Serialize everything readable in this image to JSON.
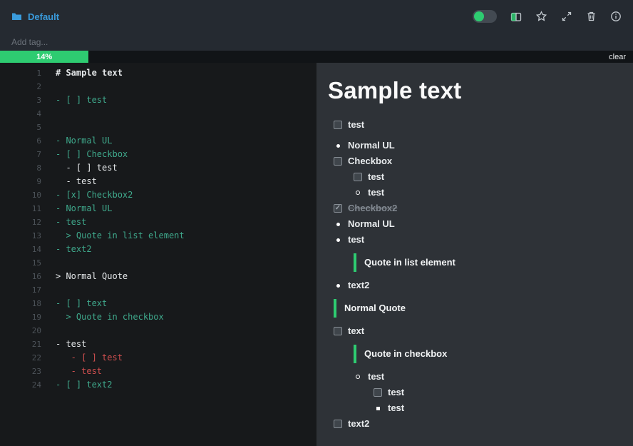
{
  "colors": {
    "accent_green": "#2ecc71",
    "accent_blue": "#3a9bdc",
    "teal_text": "#3fa98c",
    "red_text": "#cf4f4f"
  },
  "header": {
    "notebook": "Default",
    "tag_placeholder": "Add tag...",
    "icons": [
      "folder-icon",
      "preview-toggle",
      "split-view-icon",
      "star-icon",
      "expand-icon",
      "trash-icon",
      "info-icon"
    ]
  },
  "progress": {
    "value": 14,
    "percent_label": "14%",
    "clear_label": "clear"
  },
  "editor": {
    "lines": [
      {
        "num": 1,
        "text": "# Sample text",
        "color": "white",
        "bold": true
      },
      {
        "num": 2,
        "text": ""
      },
      {
        "num": 3,
        "text": "- [ ] test",
        "color": "teal"
      },
      {
        "num": 4,
        "text": ""
      },
      {
        "num": 5,
        "text": ""
      },
      {
        "num": 6,
        "text": "- Normal UL",
        "color": "teal"
      },
      {
        "num": 7,
        "text": "- [ ] Checkbox",
        "color": "teal"
      },
      {
        "num": 8,
        "text": "  - [ ] test",
        "color": "white"
      },
      {
        "num": 9,
        "text": "  - test",
        "color": "white"
      },
      {
        "num": 10,
        "text": "- [x] Checkbox2",
        "color": "teal"
      },
      {
        "num": 11,
        "text": "- Normal UL",
        "color": "teal"
      },
      {
        "num": 12,
        "text": "- test",
        "color": "teal"
      },
      {
        "num": 13,
        "text": "  > Quote in list element",
        "color": "teal"
      },
      {
        "num": 14,
        "text": "- text2",
        "color": "teal"
      },
      {
        "num": 15,
        "text": ""
      },
      {
        "num": 16,
        "text": "> Normal Quote",
        "color": "white"
      },
      {
        "num": 17,
        "text": ""
      },
      {
        "num": 18,
        "text": "- [ ] text",
        "color": "teal"
      },
      {
        "num": 19,
        "text": "  > Quote in checkbox",
        "color": "teal"
      },
      {
        "num": 20,
        "text": ""
      },
      {
        "num": 21,
        "text": "- test",
        "color": "white"
      },
      {
        "num": 22,
        "text": "   - [ ] test",
        "color": "red"
      },
      {
        "num": 23,
        "text": "   - test",
        "color": "red"
      },
      {
        "num": 24,
        "text": "- [ ] text2",
        "color": "teal"
      }
    ]
  },
  "preview": {
    "heading": "Sample text",
    "items": [
      {
        "type": "task",
        "text": "test",
        "indent": 0,
        "checked": false
      },
      {
        "type": "bullet",
        "bullet": "disc",
        "text": "Normal UL",
        "indent": 0,
        "gap": true
      },
      {
        "type": "task",
        "text": "Checkbox",
        "indent": 0,
        "checked": false
      },
      {
        "type": "task",
        "text": "test",
        "indent": 1,
        "checked": false
      },
      {
        "type": "bullet",
        "bullet": "circle",
        "text": "test",
        "indent": 1
      },
      {
        "type": "task",
        "text": "Checkbox2",
        "indent": 0,
        "checked": true,
        "strike": true
      },
      {
        "type": "bullet",
        "bullet": "disc",
        "text": "Normal UL",
        "indent": 0
      },
      {
        "type": "bullet",
        "bullet": "disc",
        "text": "test",
        "indent": 0
      },
      {
        "type": "quote",
        "text": "Quote in list element",
        "indent": 1
      },
      {
        "type": "bullet",
        "bullet": "disc",
        "text": "text2",
        "indent": 0
      },
      {
        "type": "quote",
        "text": "Normal Quote",
        "indent": 0
      },
      {
        "type": "task",
        "text": "text",
        "indent": 0,
        "checked": false
      },
      {
        "type": "quote",
        "text": "Quote in checkbox",
        "indent": 1
      },
      {
        "type": "bullet",
        "bullet": "circle",
        "text": "test",
        "indent": 1
      },
      {
        "type": "task",
        "text": "test",
        "indent": 2,
        "checked": false
      },
      {
        "type": "bullet",
        "bullet": "square",
        "text": "test",
        "indent": 2
      },
      {
        "type": "task",
        "text": "text2",
        "indent": 0,
        "checked": false
      }
    ]
  }
}
